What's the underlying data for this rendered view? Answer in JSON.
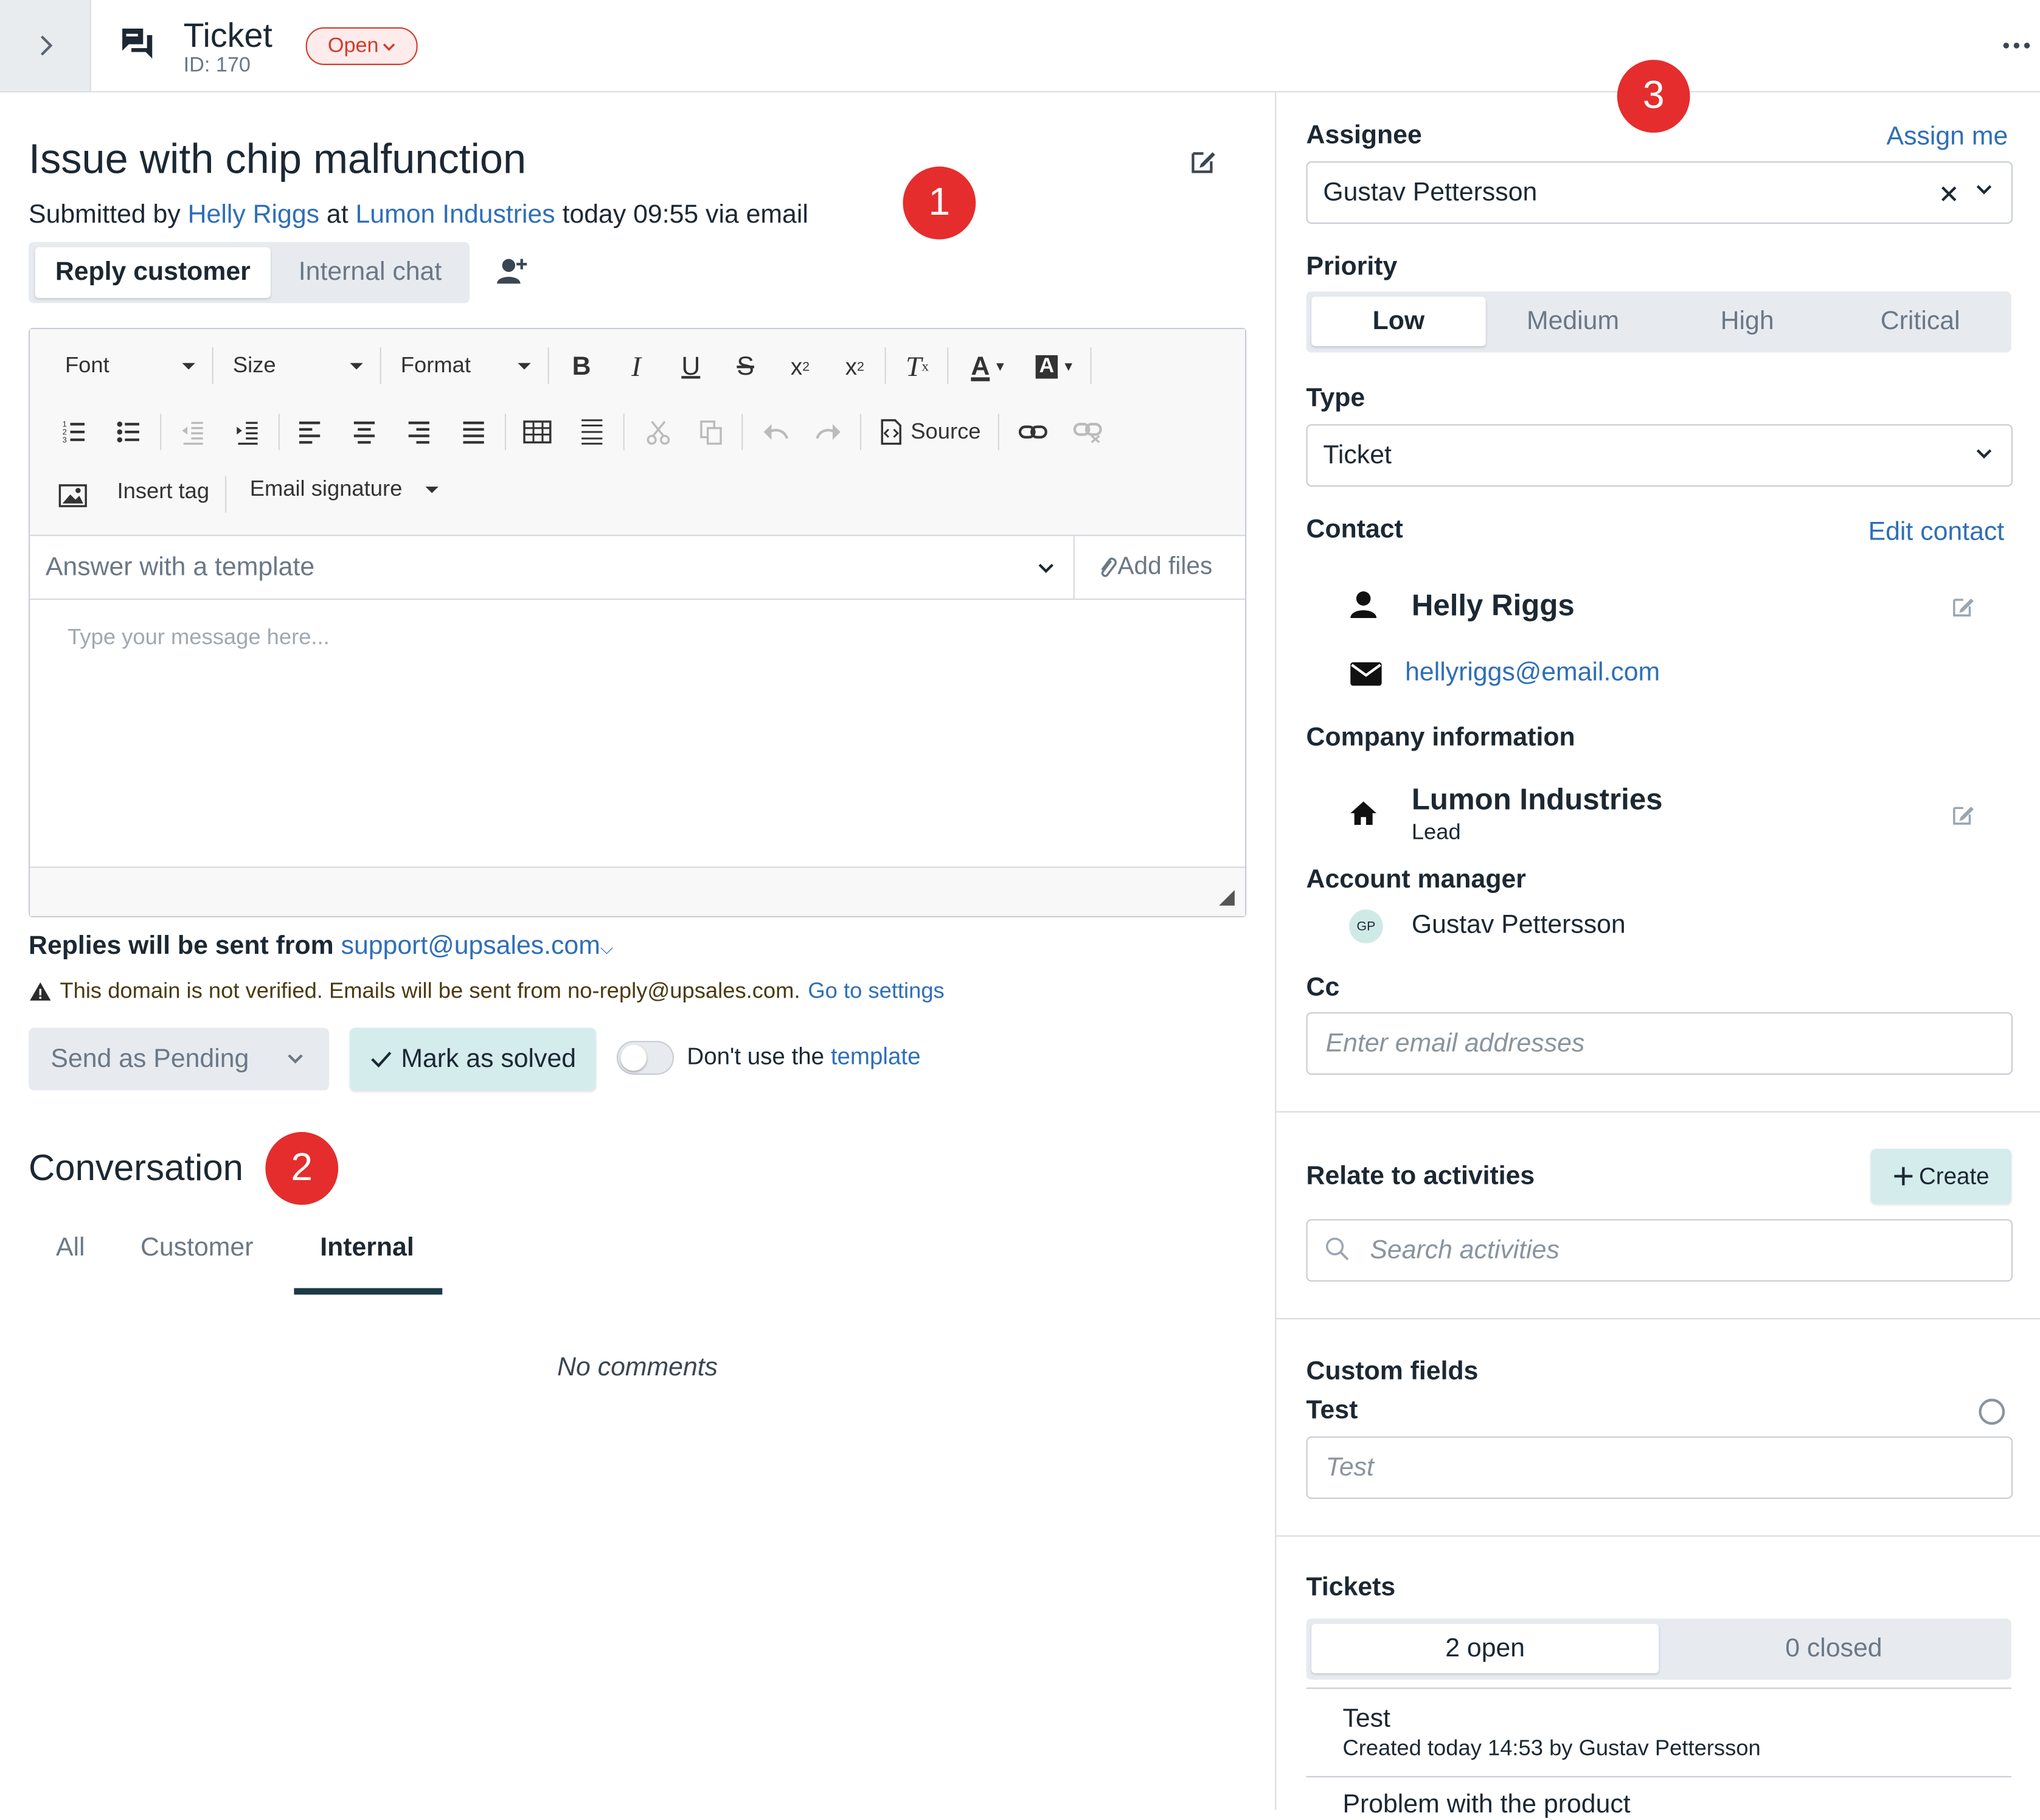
{
  "header": {
    "title": "Ticket",
    "id_text": "ID: 170",
    "status": "Open"
  },
  "ticket": {
    "subject": "Issue with chip malfunction",
    "submitted_prefix": "Submitted by",
    "submitter": "Helly Riggs",
    "at": "at",
    "company": "Lumon Industries",
    "submitted_suffix": "today 09:55 via email"
  },
  "reply_tabs": [
    "Reply customer",
    "Internal chat"
  ],
  "editor": {
    "font": "Font",
    "size": "Size",
    "format": "Format",
    "source": "Source",
    "insert_tag": "Insert tag",
    "email_signature": "Email signature",
    "template_placeholder": "Answer with a template",
    "add_files": "Add files",
    "message_placeholder": "Type your message here..."
  },
  "reply_from": {
    "label": "Replies will be sent from",
    "address": "support@upsales.com"
  },
  "warning": {
    "text": "This domain is not verified. Emails will be sent from no-reply@upsales.com.",
    "link": "Go to settings"
  },
  "actions": {
    "send_as": "Send as Pending",
    "mark_solved": "Mark as solved",
    "toggle_prefix": "Don't use the",
    "toggle_link": "template"
  },
  "conversation": {
    "title": "Conversation",
    "tabs": [
      "All",
      "Customer",
      "Internal"
    ],
    "active_tab": "Internal",
    "empty": "No comments"
  },
  "badges": [
    "1",
    "2",
    "3"
  ],
  "sidebar": {
    "assignee_label": "Assignee",
    "assign_me": "Assign me",
    "assignee": "Gustav Pettersson",
    "priority_label": "Priority",
    "priorities": [
      "Low",
      "Medium",
      "High",
      "Critical"
    ],
    "priority_selected": "Low",
    "type_label": "Type",
    "type": "Ticket",
    "contact_label": "Contact",
    "edit_contact": "Edit contact",
    "contact_name": "Helly Riggs",
    "contact_email": "hellyriggs@email.com",
    "company_label": "Company information",
    "company_name": "Lumon Industries",
    "company_stage": "Lead",
    "account_manager_label": "Account manager",
    "account_manager_initials": "GP",
    "account_manager": "Gustav Pettersson",
    "cc_label": "Cc",
    "cc_placeholder": "Enter email addresses",
    "relate_label": "Relate to activities",
    "create": "Create",
    "search_placeholder": "Search activities",
    "custom_fields_label": "Custom fields",
    "test_label": "Test",
    "test_placeholder": "Test",
    "tickets_label": "Tickets",
    "tickets_open": "2 open",
    "tickets_closed": "0 closed",
    "ticket_items": [
      {
        "title": "Test",
        "meta": "Created today 14:53 by Gustav Pettersson"
      },
      {
        "title": "Problem with the product",
        "meta": ""
      }
    ]
  },
  "colors": {
    "accent_link": "#2f6fb7",
    "badge_red": "#e52d2d",
    "solved_bg": "#d4ecec",
    "status_red": "#d33b2c"
  }
}
